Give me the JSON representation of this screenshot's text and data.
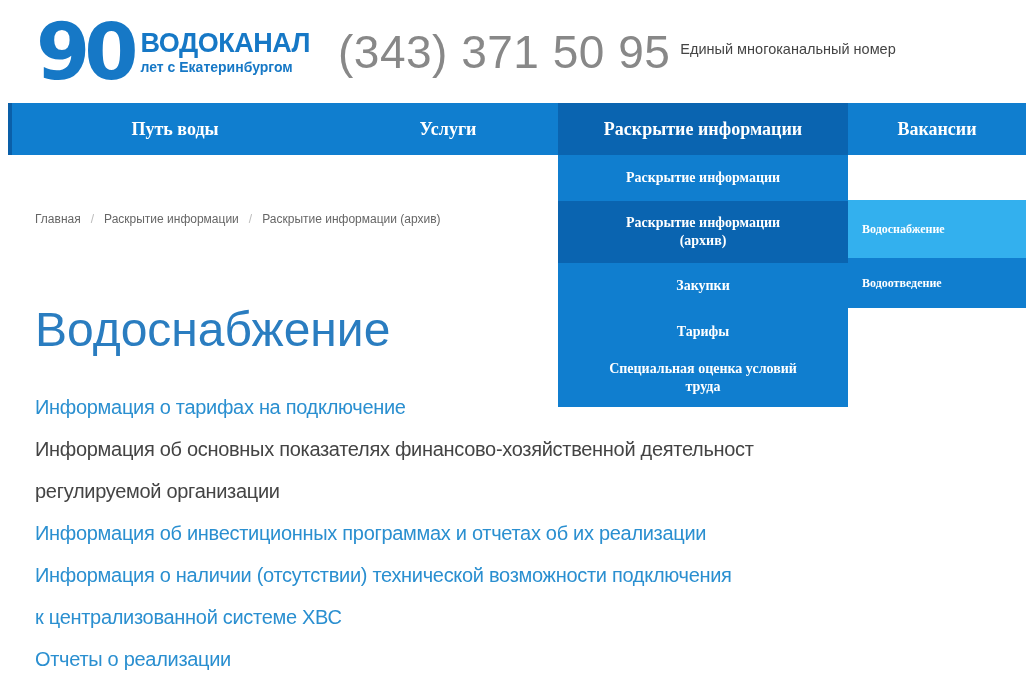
{
  "header": {
    "logo_number": "90",
    "logo_title": "ВОДОКАНАЛ",
    "logo_subtitle": "лет с Екатеринбургом",
    "phone": "(343) 371 50 95",
    "phone_note": "Единый многоканальный номер"
  },
  "nav": [
    {
      "label": "Путь воды",
      "selected": false
    },
    {
      "label": "Услуги",
      "selected": false
    },
    {
      "label": "Раскрытие информации",
      "selected": true
    },
    {
      "label": "Вакансии",
      "selected": false
    }
  ],
  "dropdown": [
    {
      "label": "Раскрытие информации",
      "selected": false
    },
    {
      "label": "Раскрытие информации (архив)",
      "selected": true
    },
    {
      "label": "Закупки",
      "selected": false
    },
    {
      "label": "Тарифы",
      "selected": false
    },
    {
      "label": "Специальная оценка условий труда",
      "selected": false
    }
  ],
  "submenu": [
    {
      "label": "Водоснабжение",
      "selected": true
    },
    {
      "label": "Водоотведение",
      "selected": false
    }
  ],
  "breadcrumb": {
    "separator": "/",
    "items": [
      "Главная",
      "Раскрытие информации",
      "Раскрытие информации (архив)"
    ]
  },
  "page_title": "Водоснабжение",
  "links": [
    {
      "lines": [
        "Информация о тарифах на подключение"
      ],
      "visited": false
    },
    {
      "lines": [
        "Информация об основных показателях финансово-хозяйственной деятельност",
        "регулируемой организации"
      ],
      "visited": true
    },
    {
      "lines": [
        "Информация об инвестиционных программах и отчетах об их реализации"
      ],
      "visited": false
    },
    {
      "lines": [
        "Информация о наличии (отсутствии) технической возможности подключения",
        "к централизованной  системе ХВС"
      ],
      "visited": false
    },
    {
      "lines": [
        "Отчеты о реализации"
      ],
      "visited": false
    }
  ]
}
